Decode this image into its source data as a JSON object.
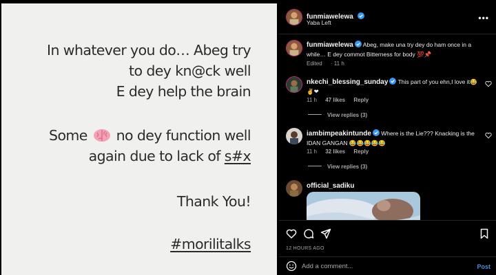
{
  "post": {
    "lines_group1": [
      "In whatever you do… Abeg try",
      "to dey kn@ck well",
      "E dey help the brain"
    ],
    "line_some_prefix": "Some",
    "line_some_suffix": "no dey function well",
    "line_again_prefix": "again due to lack of ",
    "line_again_underlined": "s#x",
    "thank_you": "Thank You!",
    "hashtag": "#morilitalks",
    "brain_icon": "brain-emoji"
  },
  "header": {
    "username": "funmiawelewa",
    "location": "Yaba Left",
    "more_icon": "more-horizontal-icon",
    "more_label": "•••"
  },
  "caption": {
    "username": "funmiawelewa",
    "text": "Abeg, make una try dey do ham once in a while… E dey commot Bitterness for body 💯📌",
    "edited": "Edited",
    "age": "11 h"
  },
  "comments": [
    {
      "username": "nkechi_blessing_sunday",
      "text": "This part of you ehn,I love it😂✌❤",
      "age": "11 h",
      "likes": "47 likes",
      "reply_label": "Reply",
      "view_replies": "View replies (3)"
    },
    {
      "username": "iambimpeakintunde",
      "text": "Where is the Lie??? Knacking is the IDAN GANGAN 😂😂😂😂😂",
      "age": "11 h",
      "likes": "32 likes",
      "reply_label": "Reply",
      "view_replies": "View replies (3)"
    },
    {
      "username": "official_sadiku"
    }
  ],
  "actions": {
    "icons": [
      "heart-icon",
      "comment-icon",
      "share-icon",
      "bookmark-icon"
    ],
    "timestamp": "12 HOURS AGO"
  },
  "comment_box": {
    "placeholder": "Add a comment...",
    "post_label": "Post",
    "emoji_icon": "smiley-icon"
  },
  "colors": {
    "background": "#000000",
    "post_card": "#f0f0ef",
    "post_text": "#2b2b2b",
    "verified": "#3897f0",
    "link": "#4a8fd9",
    "heart": "#ed4956",
    "muted": "#a8a8a8"
  }
}
